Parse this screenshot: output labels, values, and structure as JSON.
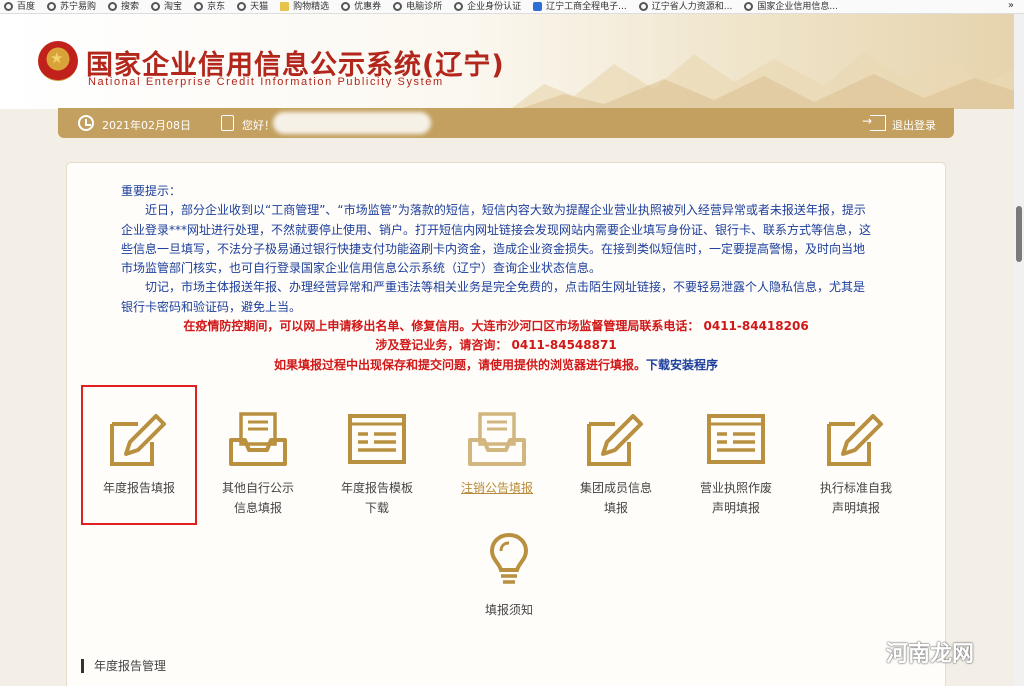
{
  "bookmarks": [
    {
      "label": "百度",
      "icon": "globe-icon"
    },
    {
      "label": "苏宁易购",
      "icon": "globe-icon"
    },
    {
      "label": "搜索",
      "icon": "globe-icon"
    },
    {
      "label": "淘宝",
      "icon": "globe-icon"
    },
    {
      "label": "京东",
      "icon": "globe-icon"
    },
    {
      "label": "天猫",
      "icon": "globe-icon"
    },
    {
      "label": "购物精选",
      "icon": "folder-icon"
    },
    {
      "label": "优惠券",
      "icon": "globe-icon"
    },
    {
      "label": "电脑诊所",
      "icon": "globe-icon"
    },
    {
      "label": "企业身份认证",
      "icon": "globe-icon"
    },
    {
      "label": "辽宁工商全程电子...",
      "icon": "shield-icon"
    },
    {
      "label": "辽宁省人力资源和...",
      "icon": "globe-icon"
    },
    {
      "label": "国家企业信用信息...",
      "icon": "globe-icon"
    }
  ],
  "bookmarks_more": "»",
  "header": {
    "title_cn": "国家企业信用信息公示系统(辽宁)",
    "title_en": "National Enterprise Credit Information Publicity System"
  },
  "userbar": {
    "date": "2021年02月08日",
    "greeting": "您好！",
    "logout": "退出登录"
  },
  "notice": {
    "heading": "重要提示：",
    "para1": "近日，部分企业收到以“工商管理”、“市场监管”为落款的短信，短信内容大致为提醒企业营业执照被列入经营异常或者未报送年报，提示企业登录***网址进行处理，不然就要停止使用、销户。打开短信内网址链接会发现网站内需要企业填写身份证、银行卡、联系方式等信息，这些信息一旦填写，不法分子极易通过银行快捷支付功能盗刷卡内资金，造成企业资金损失。在接到类似短信时，一定要提高警惕，及时向当地市场监管部门核实，也可自行登录国家企业信用信息公示系统（辽宁）查询企业状态信息。",
    "para2": "切记，市场主体报送年报、办理经营异常和严重违法等相关业务是完全免费的，点击陌生网址链接，不要轻易泄露个人隐私信息，尤其是银行卡密码和验证码，避免上当。",
    "red1": "在疫情防控期间，可以网上申请移出名单、修复信用。大连市沙河口区市场监督管理局联系电话：  0411-84418206",
    "red2": "涉及登记业务，请咨询：  0411-84548871",
    "red3": "如果填报过程中出现保存和提交问题，请使用提供的浏览器进行填报。",
    "download_link": "下载安装程序"
  },
  "tiles": [
    {
      "line1": "年度报告填报",
      "line2": "",
      "icon": "pencil-edit-icon"
    },
    {
      "line1": "其他自行公示",
      "line2": "信息填报",
      "icon": "inbox-tray-icon"
    },
    {
      "line1": "年度报告模板",
      "line2": "下载",
      "icon": "template-list-icon"
    },
    {
      "line1": "注销公告填报",
      "line2": "",
      "icon": "inbox-tray-icon"
    },
    {
      "line1": "集团成员信息",
      "line2": "填报",
      "icon": "pencil-edit-icon"
    },
    {
      "line1": "营业执照作废",
      "line2": "声明填报",
      "icon": "template-list-icon"
    },
    {
      "line1": "执行标准自我",
      "line2": "声明填报",
      "icon": "pencil-edit-icon"
    },
    {
      "line1": "填报须知",
      "line2": "",
      "icon": "lightbulb-icon"
    }
  ],
  "section_title": "年度报告管理",
  "watermark": "河南龙网",
  "colors": {
    "accent": "#c3a05f",
    "icon": "#b8903f",
    "title_red": "#b2261c",
    "notice_blue": "#1d3f9c",
    "warning_red": "#d01818"
  }
}
